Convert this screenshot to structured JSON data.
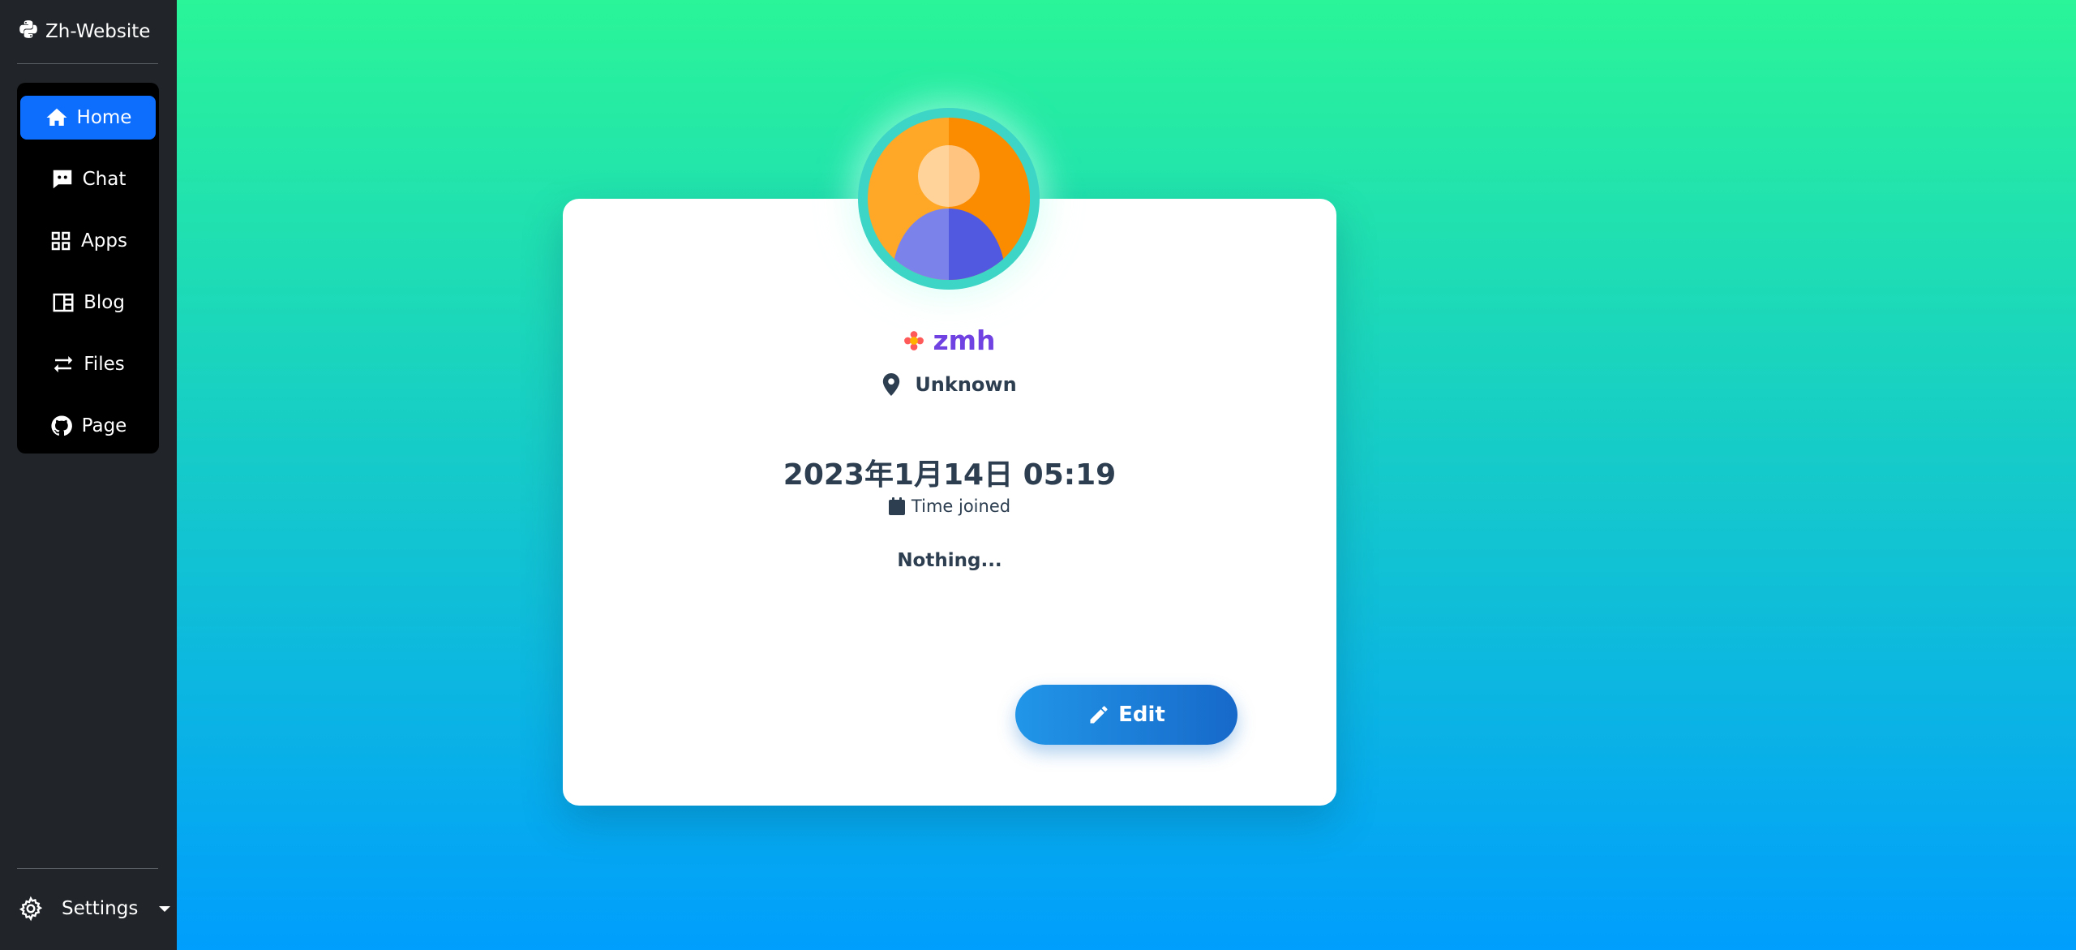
{
  "brand": {
    "name": "Zh-Website",
    "icon": "python-icon"
  },
  "sidebar": {
    "items": [
      {
        "label": "Home",
        "icon": "home-icon",
        "active": true
      },
      {
        "label": "Chat",
        "icon": "chat-icon",
        "active": false
      },
      {
        "label": "Apps",
        "icon": "apps-grid-icon",
        "active": false
      },
      {
        "label": "Blog",
        "icon": "blog-icon",
        "active": false
      },
      {
        "label": "Files",
        "icon": "transfer-arrows-icon",
        "active": false
      },
      {
        "label": "Page",
        "icon": "github-icon",
        "active": false
      }
    ],
    "settings_label": "Settings"
  },
  "profile": {
    "username": "zmh",
    "location": "Unknown",
    "joined_date": "2023年1月14日 05:19",
    "joined_label": "Time joined",
    "bio": "Nothing...",
    "edit_label": "Edit"
  },
  "colors": {
    "sidebar_bg": "#212529",
    "active_nav": "#0d6efd",
    "gradient_top": "#2af598",
    "gradient_bottom": "#009efd",
    "username": "#6f42e1",
    "text": "#2c3e50"
  }
}
